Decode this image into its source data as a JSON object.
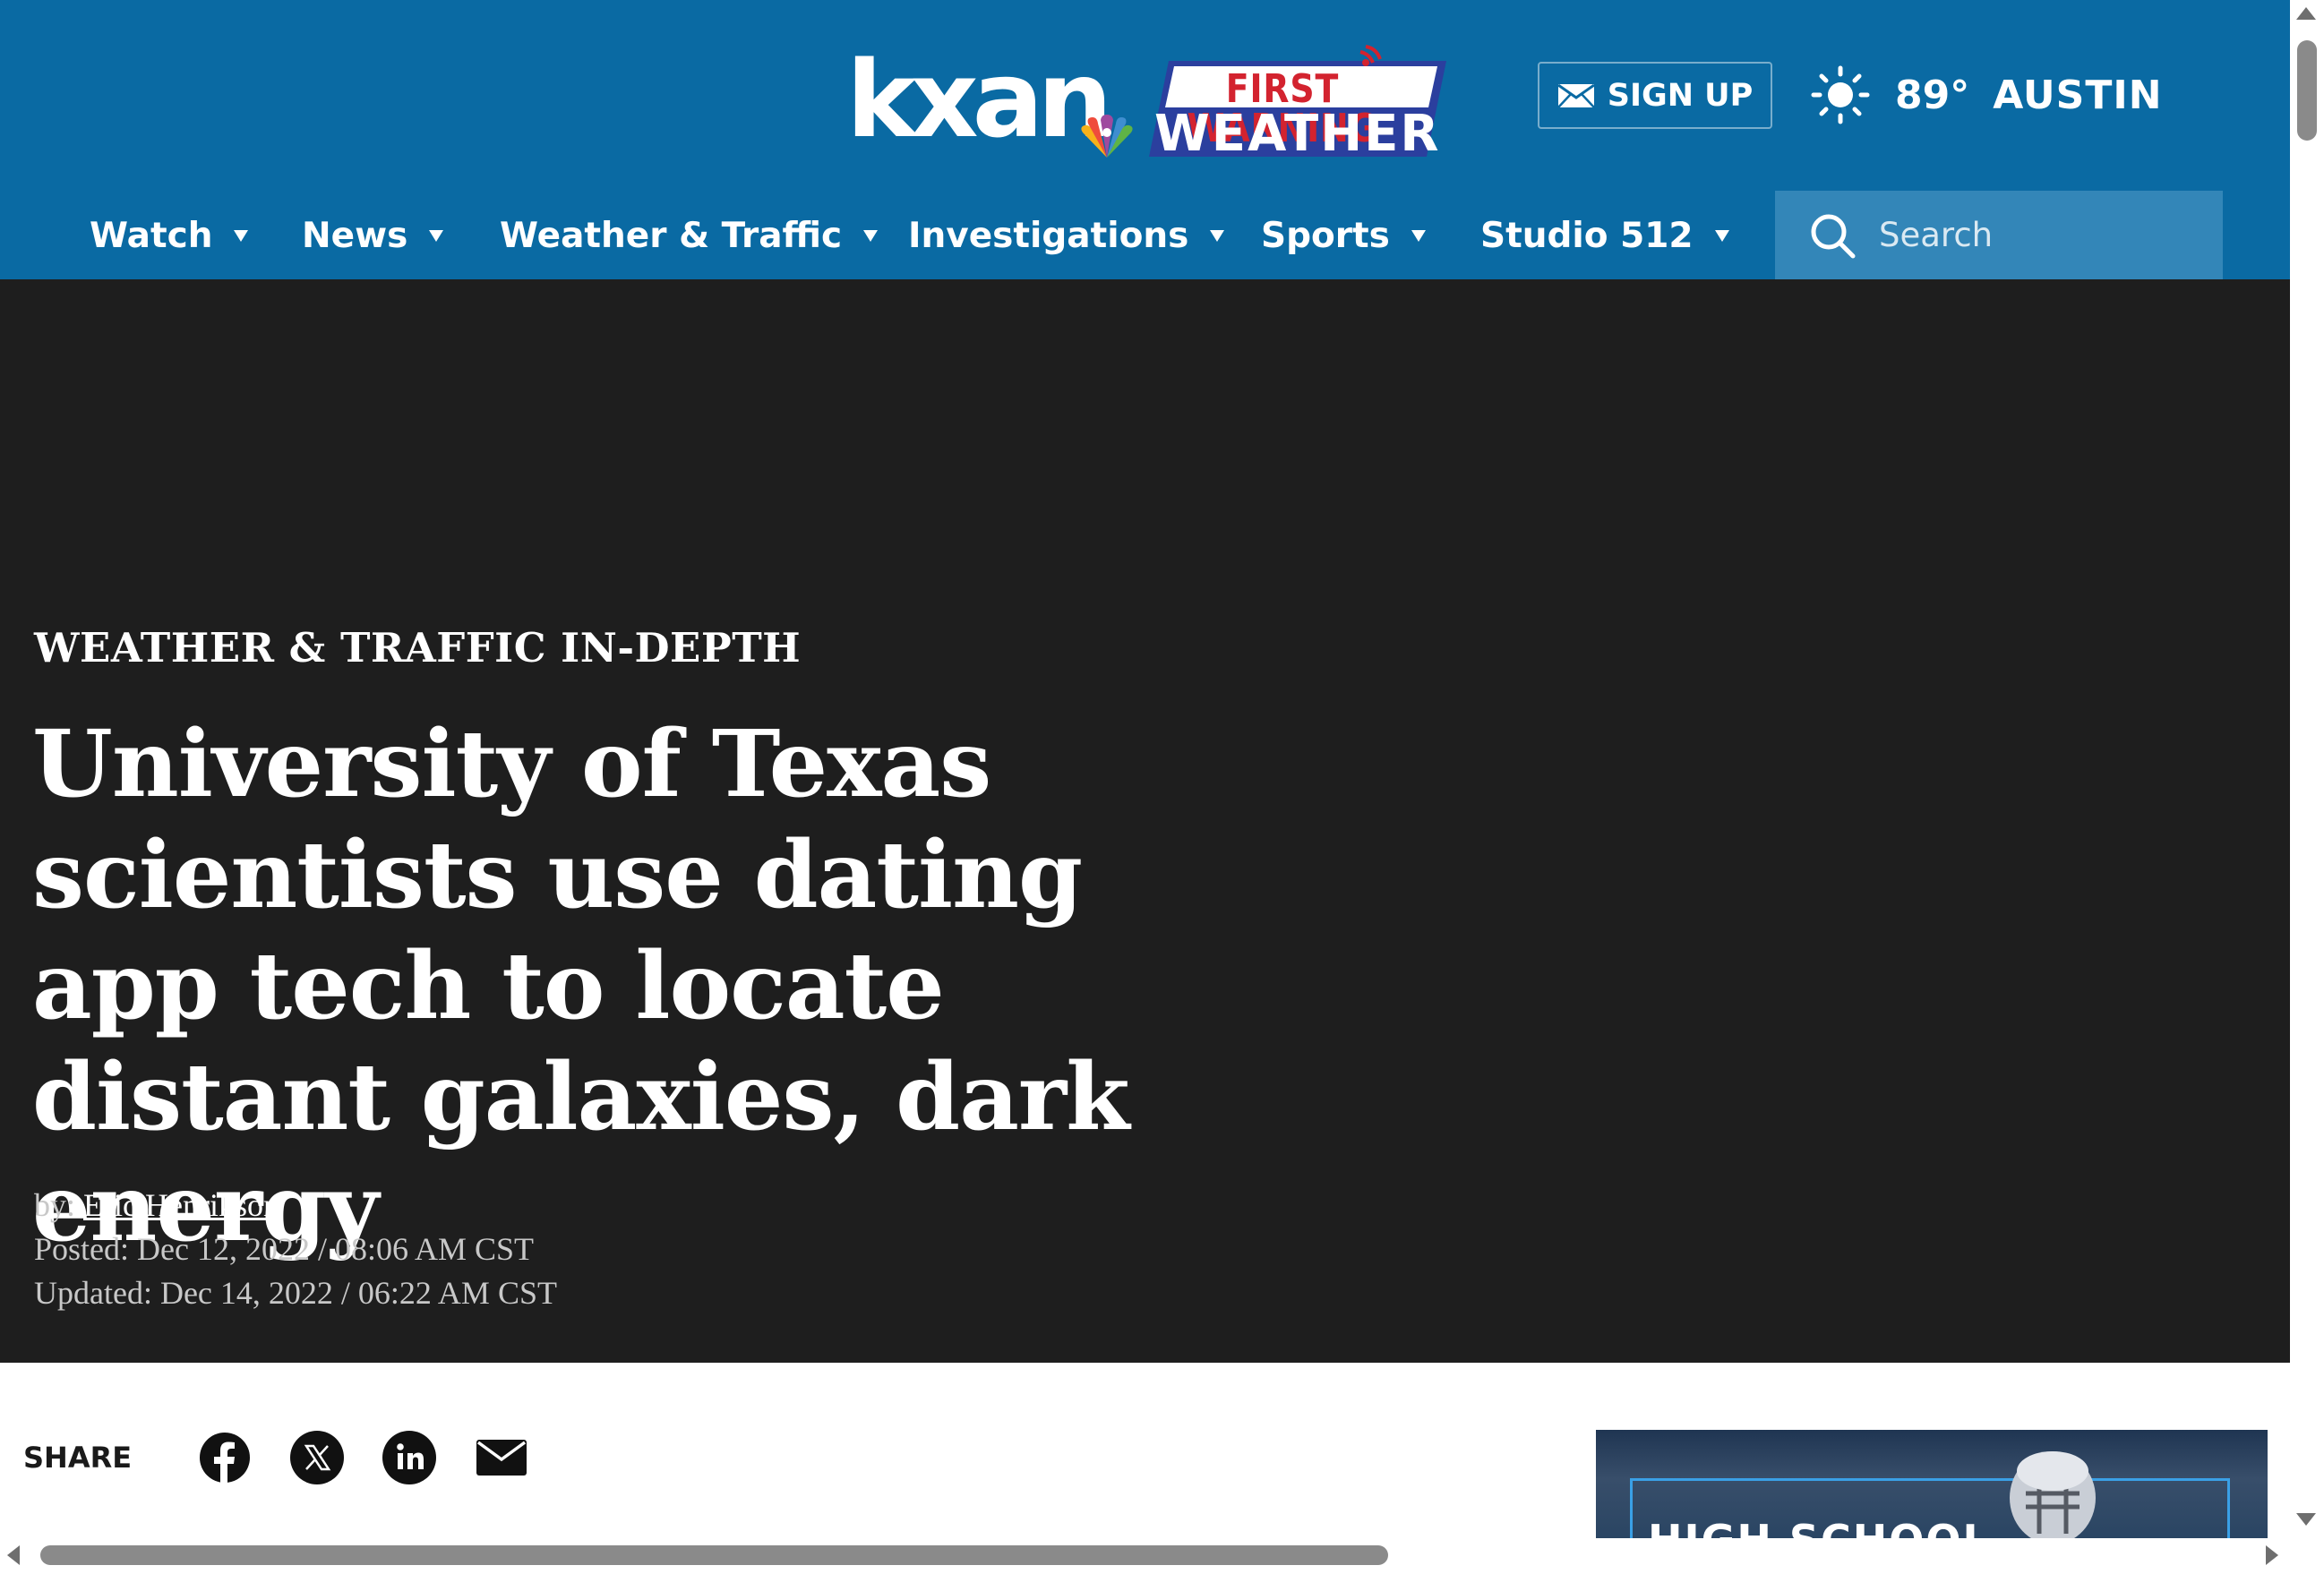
{
  "header": {
    "logo_text": "kxan",
    "badge_top": "FIRST WARNING",
    "badge_bottom": "WEATHER",
    "signup_label": "SIGN UP",
    "signup_icon": "envelope-icon",
    "weather": {
      "icon": "sun-icon",
      "temperature": "89°",
      "city": "AUSTIN"
    }
  },
  "nav": {
    "items": [
      {
        "label": "Watch"
      },
      {
        "label": "News"
      },
      {
        "label": "Weather & Traffic"
      },
      {
        "label": "Investigations"
      },
      {
        "label": "Sports"
      },
      {
        "label": "Studio 512"
      }
    ],
    "search_placeholder": "Search"
  },
  "article": {
    "kicker": "WEATHER & TRAFFIC IN-DEPTH",
    "headline": "University of Texas scientists use dating app tech to locate distant galaxies, dark energy",
    "byline_prefix": "by: ",
    "author": "Eric Henrikson",
    "posted": "Posted: Dec 12, 2022 / 08:06 AM CST",
    "updated": "Updated: Dec 14, 2022 / 06:22 AM CST"
  },
  "share": {
    "label": "SHARE",
    "buttons": [
      "facebook-icon",
      "x-icon",
      "linkedin-icon",
      "email-icon"
    ]
  },
  "ad": {
    "text": "HIGH SCHOOL"
  },
  "colors": {
    "header_bg": "#0a6aa3",
    "search_bg": "#3386b8",
    "hero_bg": "#1e1e1e",
    "badge_red": "#d3232f",
    "badge_blue": "#2b3f9e"
  }
}
